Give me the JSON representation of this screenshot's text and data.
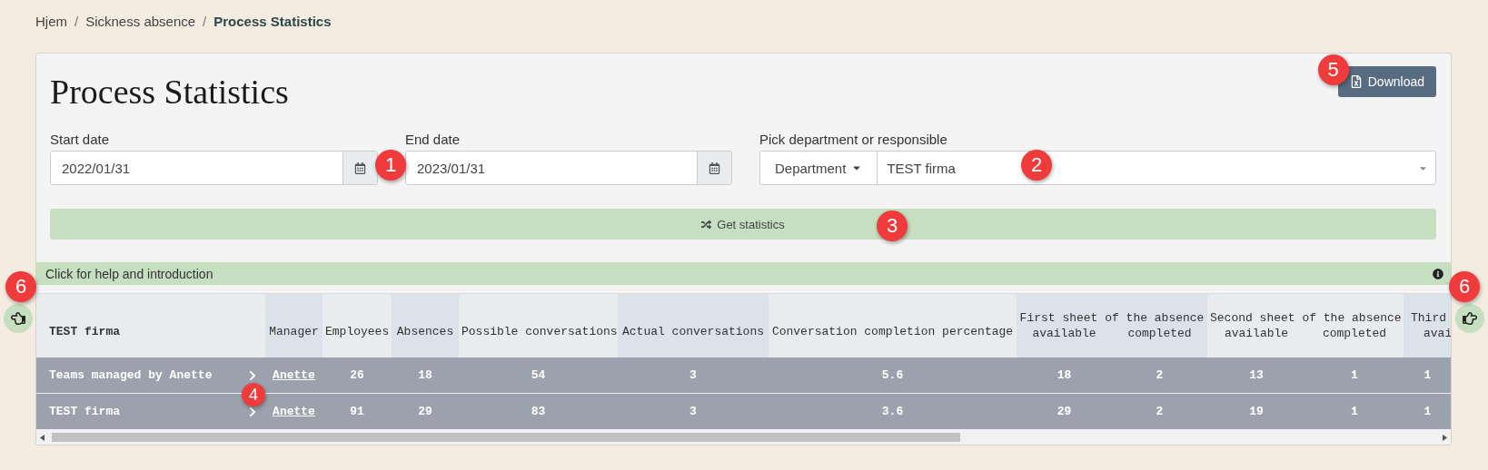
{
  "breadcrumb": [
    {
      "label": "Hjem",
      "current": false
    },
    {
      "label": "Sickness absence",
      "current": false
    },
    {
      "label": "Process Statistics",
      "current": true
    }
  ],
  "breadcrumb_separator": "/",
  "title": "Process Statistics",
  "download_button": {
    "label": "Download",
    "callout": "5"
  },
  "start_date": {
    "label": "Start date",
    "value": "2022/01/31",
    "callout": "1"
  },
  "end_date": {
    "label": "End date",
    "value": "2023/01/31"
  },
  "department_picker": {
    "label": "Pick department or responsible",
    "mode": "Department",
    "value": "TEST firma",
    "callout": "2"
  },
  "get_statistics_button": {
    "label": "Get statistics",
    "callout": "3"
  },
  "help_bar": {
    "label": "Click for help and introduction"
  },
  "side_buttons": [
    {
      "kind": "left",
      "callout": "6"
    },
    {
      "kind": "right",
      "callout": "6"
    }
  ],
  "table": {
    "name_callout": "4",
    "columns": [
      {
        "label": "TEST firma",
        "kind": "name",
        "shaded": false
      },
      {
        "label": "Manager",
        "kind": "link",
        "shaded": true
      },
      {
        "label": "Employees",
        "kind": "number",
        "shaded": false
      },
      {
        "label": "Absences",
        "kind": "number",
        "shaded": true
      },
      {
        "label": "Possible conversations",
        "kind": "number",
        "shaded": false
      },
      {
        "label": "Actual conversations",
        "kind": "number",
        "shaded": true
      },
      {
        "label": "Conversation completion percentage",
        "kind": "number",
        "shaded": false
      }
    ],
    "groups": [
      {
        "label": "First sheet of the absence",
        "shaded": true,
        "columns": [
          "available",
          "completed"
        ]
      },
      {
        "label": "Second sheet of the absence",
        "shaded": false,
        "columns": [
          "available",
          "completed"
        ]
      },
      {
        "label": "Third",
        "shaded": true,
        "columns": [
          "avai"
        ]
      }
    ],
    "rows": [
      {
        "cells": [
          "Teams managed by Anette",
          "Anette",
          "26",
          "18",
          "54",
          "3",
          "5.6",
          "18",
          "2",
          "13",
          "1",
          "1"
        ]
      },
      {
        "cells": [
          "TEST firma",
          "Anette",
          "91",
          "29",
          "83",
          "3",
          "3.6",
          "29",
          "2",
          "19",
          "1",
          "1"
        ]
      }
    ]
  }
}
